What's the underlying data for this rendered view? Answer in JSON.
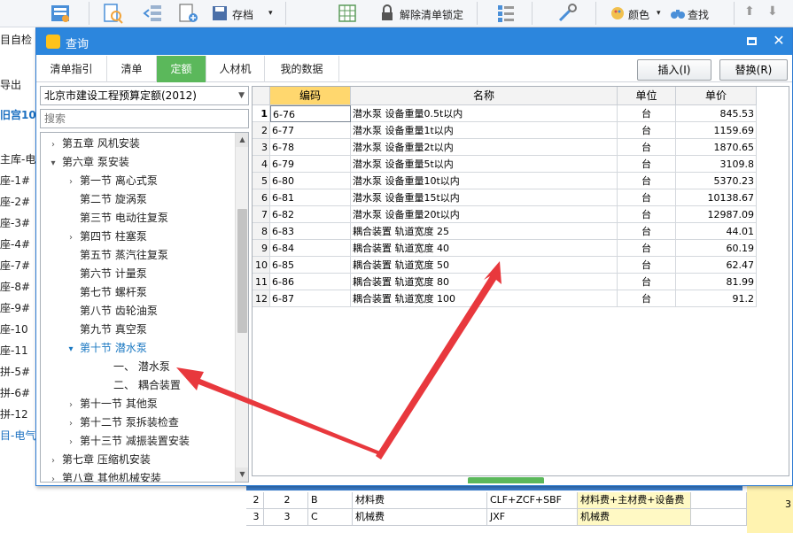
{
  "toolbar": {
    "save_label": "存档",
    "unlock_label": "解除清单锁定",
    "color_label": "颜色",
    "find_label": "查找"
  },
  "background": {
    "left_items": [
      "目自检",
      "导出",
      "旧宫10",
      "主库-电",
      "座-1#",
      "座-2#",
      "座-3#",
      "座-4#",
      "座-7#",
      "座-8#",
      "座-9#",
      "座-10",
      "座-11",
      "拼-5#",
      "拼-6#",
      "拼-12",
      "目-电气"
    ],
    "table_rows": [
      {
        "row": "2",
        "seq": "2",
        "code": "B",
        "name": "材料费",
        "formula": "CLF+ZCF+SBF",
        "desc": "材料费+主材费+设备费",
        "value": "3"
      },
      {
        "row": "3",
        "seq": "3",
        "code": "C",
        "name": "机械费",
        "formula": "JXF",
        "desc": "机械费",
        "value": ""
      }
    ]
  },
  "dialog": {
    "title": "查询",
    "tabs": [
      "清单指引",
      "清单",
      "定额",
      "人材机",
      "我的数据"
    ],
    "active_tab": "定额",
    "insert_button": "插入(I)",
    "replace_button": "替换(R)",
    "quota_library": "北京市建设工程预算定额(2012)",
    "search_placeholder": "搜索"
  },
  "tree": {
    "items": [
      {
        "label": "第五章  风机安装",
        "level": 1,
        "arrow": "›",
        "selected": false
      },
      {
        "label": "第六章  泵安装",
        "level": 1,
        "arrow": "⌄",
        "selected": false
      },
      {
        "label": "第一节  离心式泵",
        "level": 2,
        "arrow": "›",
        "selected": false
      },
      {
        "label": "第二节  旋涡泵",
        "level": 2,
        "arrow": "",
        "selected": false
      },
      {
        "label": "第三节  电动往复泵",
        "level": 2,
        "arrow": "",
        "selected": false
      },
      {
        "label": "第四节  柱塞泵",
        "level": 2,
        "arrow": "›",
        "selected": false
      },
      {
        "label": "第五节  蒸汽往复泵",
        "level": 2,
        "arrow": "",
        "selected": false
      },
      {
        "label": "第六节  计量泵",
        "level": 2,
        "arrow": "",
        "selected": false
      },
      {
        "label": "第七节  螺杆泵",
        "level": 2,
        "arrow": "",
        "selected": false
      },
      {
        "label": "第八节  齿轮油泵",
        "level": 2,
        "arrow": "",
        "selected": false
      },
      {
        "label": "第九节  真空泵",
        "level": 2,
        "arrow": "",
        "selected": false
      },
      {
        "label": "第十节  潜水泵",
        "level": 2,
        "arrow": "⌄",
        "selected": true
      },
      {
        "label": "一、  潜水泵",
        "level": 3,
        "arrow": "",
        "selected": false
      },
      {
        "label": "二、  耦合装置",
        "level": 3,
        "arrow": "",
        "selected": false
      },
      {
        "label": "第十一节  其他泵",
        "level": 2,
        "arrow": "›",
        "selected": false
      },
      {
        "label": "第十二节  泵拆装检查",
        "level": 2,
        "arrow": "›",
        "selected": false
      },
      {
        "label": "第十三节  减振装置安装",
        "level": 2,
        "arrow": "›",
        "selected": false
      },
      {
        "label": "第七章  压缩机安装",
        "level": 1,
        "arrow": "›",
        "selected": false
      },
      {
        "label": "第八章  其他机械安装",
        "level": 1,
        "arrow": "›",
        "selected": false
      }
    ]
  },
  "grid": {
    "headers": {
      "code": "编码",
      "name": "名称",
      "unit": "单位",
      "price": "单价"
    },
    "rows": [
      {
        "n": "1",
        "code": "6-76",
        "name": "潜水泵  设备重量0.5t以内",
        "unit": "台",
        "price": "845.53"
      },
      {
        "n": "2",
        "code": "6-77",
        "name": "潜水泵  设备重量1t以内",
        "unit": "台",
        "price": "1159.69"
      },
      {
        "n": "3",
        "code": "6-78",
        "name": "潜水泵  设备重量2t以内",
        "unit": "台",
        "price": "1870.65"
      },
      {
        "n": "4",
        "code": "6-79",
        "name": "潜水泵  设备重量5t以内",
        "unit": "台",
        "price": "3109.8"
      },
      {
        "n": "5",
        "code": "6-80",
        "name": "潜水泵  设备重量10t以内",
        "unit": "台",
        "price": "5370.23"
      },
      {
        "n": "6",
        "code": "6-81",
        "name": "潜水泵  设备重量15t以内",
        "unit": "台",
        "price": "10138.67"
      },
      {
        "n": "7",
        "code": "6-82",
        "name": "潜水泵  设备重量20t以内",
        "unit": "台",
        "price": "12987.09"
      },
      {
        "n": "8",
        "code": "6-83",
        "name": "耦合装置  轨道宽度  25",
        "unit": "台",
        "price": "44.01"
      },
      {
        "n": "9",
        "code": "6-84",
        "name": "耦合装置  轨道宽度  40",
        "unit": "台",
        "price": "60.19"
      },
      {
        "n": "10",
        "code": "6-85",
        "name": "耦合装置  轨道宽度  50",
        "unit": "台",
        "price": "62.47"
      },
      {
        "n": "11",
        "code": "6-86",
        "name": "耦合装置  轨道宽度  80",
        "unit": "台",
        "price": "81.99"
      },
      {
        "n": "12",
        "code": "6-87",
        "name": "耦合装置  轨道宽度  100",
        "unit": "台",
        "price": "91.2"
      }
    ]
  },
  "colors": {
    "titlebar": "#2c86dd",
    "active_tab": "#5bb85b",
    "code_header": "#ffd76e",
    "annotation_arrow": "#e8383d"
  }
}
